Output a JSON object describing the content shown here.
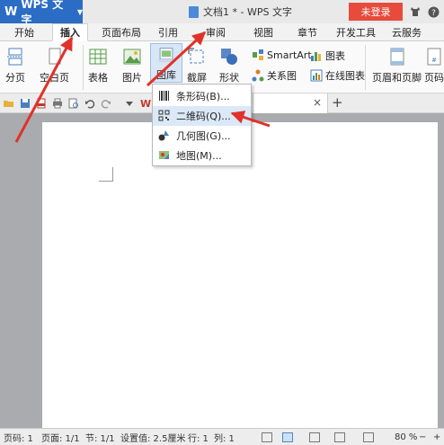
{
  "app": {
    "logo": "WPS 文字",
    "window_title": "文档1 * - WPS 文字",
    "login": "未登录"
  },
  "menu": {
    "tabs": [
      "开始",
      "插入",
      "页面布局",
      "引用",
      "审阅",
      "视图",
      "章节",
      "开发工具",
      "云服务"
    ],
    "active_tab": "插入"
  },
  "ribbon": {
    "page_break": "分页",
    "blank_page": "空白页",
    "table": "表格",
    "picture": "图片",
    "gallery": "图库",
    "screenshot": "截屏",
    "shapes": "形状",
    "smartart": "SmartArt",
    "chart": "图表",
    "relation": "关系图",
    "online_chart": "在线图表",
    "header_footer": "页眉和页脚",
    "page_number": "页码"
  },
  "dropdown": {
    "items": [
      {
        "label": "条形码(B)...",
        "icon": "barcode-icon"
      },
      {
        "label": "二维码(Q)...",
        "icon": "qrcode-icon"
      },
      {
        "label": "几何图(G)...",
        "icon": "geometry-icon"
      },
      {
        "label": "地图(M)...",
        "icon": "map-icon"
      }
    ]
  },
  "statusbar": {
    "page_num": "页码: 1",
    "pages": "页面: 1/1",
    "section": "节: 1/1",
    "setting": "设置值: 2.5厘米",
    "row": "行: 1",
    "col": "列: 1",
    "zoom": "80 %"
  },
  "colors": {
    "brand_blue": "#2b6cc4",
    "login_red": "#e64b3c",
    "annotation_arrow": "#e0322a"
  }
}
